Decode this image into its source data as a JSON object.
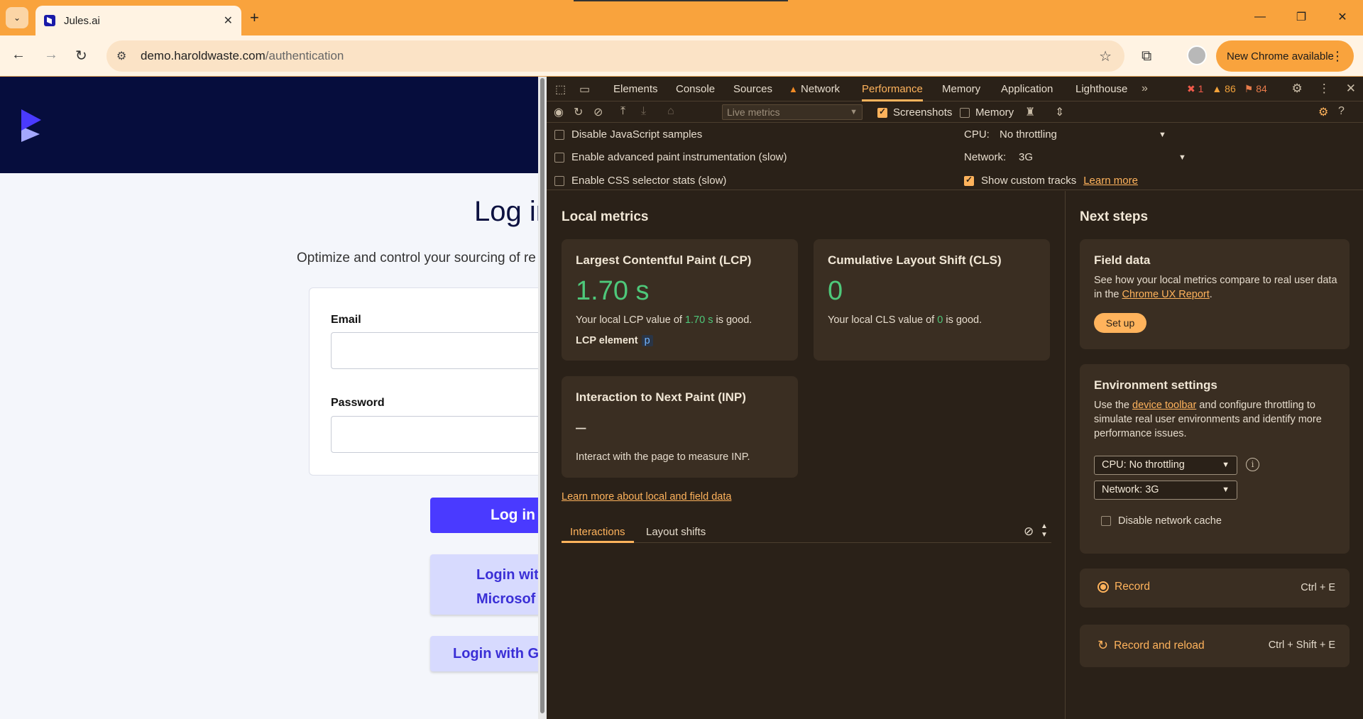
{
  "browser": {
    "tab_title": "Jules.ai",
    "url_host": "demo.haroldwaste.com",
    "url_path": "/authentication",
    "update_label": "New Chrome available"
  },
  "page": {
    "login_title": "Log in",
    "subtitle": "Optimize and control your sourcing of re",
    "email_label": "Email",
    "password_label": "Password",
    "login_button": "Log in",
    "microsoft_line1": "Login wit",
    "microsoft_line2": "Microsof",
    "google_button": "Login with Go"
  },
  "devtools": {
    "tabs": [
      "Elements",
      "Console",
      "Sources",
      "Network",
      "Performance",
      "Memory",
      "Application",
      "Lighthouse"
    ],
    "active_tab": "Performance",
    "errors": "1",
    "warnings": "86",
    "issues": "84",
    "toolbar": {
      "live_metrics": "Live metrics",
      "screenshots": "Screenshots",
      "memory": "Memory"
    },
    "settings": {
      "disable_js": "Disable JavaScript samples",
      "advanced_paint": "Enable advanced paint instrumentation (slow)",
      "css_selector": "Enable CSS selector stats (slow)",
      "cpu_label": "CPU:",
      "cpu_value": "No throttling",
      "network_label": "Network:",
      "network_value": "3G",
      "custom_tracks": "Show custom tracks",
      "learn_more": "Learn more"
    },
    "local_metrics": {
      "title": "Local metrics",
      "lcp": {
        "heading": "Largest Contentful Paint (LCP)",
        "value": "1.70 s",
        "desc_prefix": "Your local LCP value of ",
        "desc_value": "1.70 s",
        "desc_suffix": " is good.",
        "element_label": "LCP element",
        "element_tag": "p"
      },
      "cls": {
        "heading": "Cumulative Layout Shift (CLS)",
        "value": "0",
        "desc_prefix": "Your local CLS value of ",
        "desc_value": "0",
        "desc_suffix": " is good."
      },
      "inp": {
        "heading": "Interaction to Next Paint (INP)",
        "value": "–",
        "desc": "Interact with the page to measure INP."
      },
      "learn_link": "Learn more about local and field data",
      "subtabs": [
        "Interactions",
        "Layout shifts"
      ]
    },
    "next_steps": {
      "title": "Next steps",
      "field_data": {
        "heading": "Field data",
        "text_prefix": "See how your local metrics compare to real user data in the ",
        "link": "Chrome UX Report",
        "text_suffix": ".",
        "button": "Set up"
      },
      "environment": {
        "heading": "Environment settings",
        "text_prefix": "Use the ",
        "link": "device toolbar",
        "text_suffix": " and configure throttling to simulate real user environments and identify more performance issues.",
        "cpu_select": "CPU: No throttling",
        "network_select": "Network: 3G",
        "disable_cache": "Disable network cache"
      },
      "record": {
        "label": "Record",
        "shortcut": "Ctrl + E"
      },
      "record_reload": {
        "label": "Record and reload",
        "shortcut": "Ctrl + Shift + E"
      }
    }
  },
  "colors": {
    "accent": "#ffb35c",
    "good": "#4ec87a",
    "brand": "#4a3aff",
    "chrome_frame": "#f9a33d"
  }
}
